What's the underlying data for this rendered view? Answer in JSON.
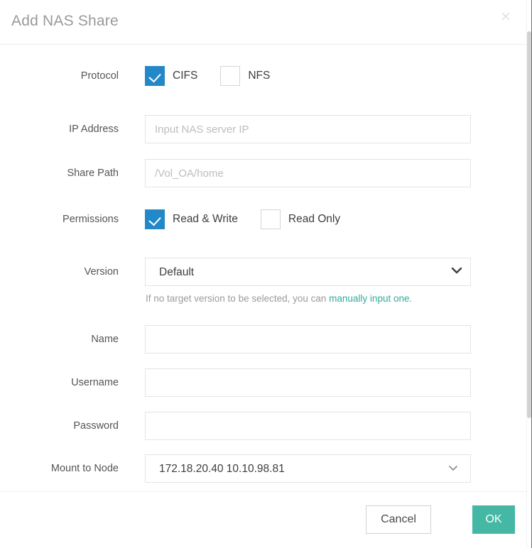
{
  "dialog": {
    "title": "Add NAS Share",
    "close_label": "×"
  },
  "fields": {
    "protocol": {
      "label": "Protocol",
      "options": [
        {
          "label": "CIFS",
          "checked": true
        },
        {
          "label": "NFS",
          "checked": false
        }
      ]
    },
    "ip_address": {
      "label": "IP Address",
      "value": "",
      "placeholder": "Input NAS server IP"
    },
    "share_path": {
      "label": "Share Path",
      "value": "",
      "placeholder": "/Vol_OA/home"
    },
    "permissions": {
      "label": "Permissions",
      "options": [
        {
          "label": "Read & Write",
          "checked": true
        },
        {
          "label": "Read Only",
          "checked": false
        }
      ]
    },
    "version": {
      "label": "Version",
      "value": "Default",
      "hint_before": "If no target version to be selected, you can ",
      "hint_link": "manually input one",
      "hint_after": "."
    },
    "name": {
      "label": "Name",
      "value": "",
      "placeholder": ""
    },
    "username": {
      "label": "Username",
      "value": "",
      "placeholder": ""
    },
    "password": {
      "label": "Password",
      "value": "",
      "placeholder": ""
    },
    "mount_to_node": {
      "label": "Mount to Node",
      "value": "172.18.20.40 10.10.98.81"
    }
  },
  "footer": {
    "cancel_label": "Cancel",
    "ok_label": "OK"
  },
  "colors": {
    "checkbox_checked": "#2288c8",
    "primary_button": "#45b8a5",
    "link": "#33aa9e",
    "title_text": "#9a9a9a",
    "label_text": "#555555",
    "placeholder_text": "#bdbdbd",
    "input_border": "#e4e4e4"
  }
}
